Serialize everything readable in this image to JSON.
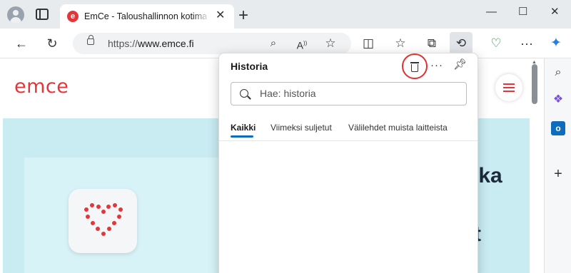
{
  "browser": {
    "tab": {
      "favicon_letter": "e",
      "title": "EmCe - Taloushallinnon kotimainen"
    },
    "window_controls": {
      "minimize": "—",
      "maximize": "☐",
      "close": "✕"
    },
    "address": {
      "protocol": "https://",
      "host": "www.emce.fi"
    }
  },
  "page": {
    "logo": "emce",
    "hero_fragments": [
      "oka",
      "t"
    ]
  },
  "history_panel": {
    "title": "Historia",
    "search_placeholder": "Hae: historia",
    "tabs": [
      {
        "label": "Kaikki",
        "active": true
      },
      {
        "label": "Viimeksi suljetut",
        "active": false
      },
      {
        "label": "Välilehdet muista laitteista",
        "active": false
      }
    ],
    "more_label": "···"
  },
  "colors": {
    "brand_red": "#e2363a",
    "highlight_circle": "#e0312f",
    "active_tab_underline": "#0f6cbd",
    "hero_background": "#c9ecf3"
  }
}
